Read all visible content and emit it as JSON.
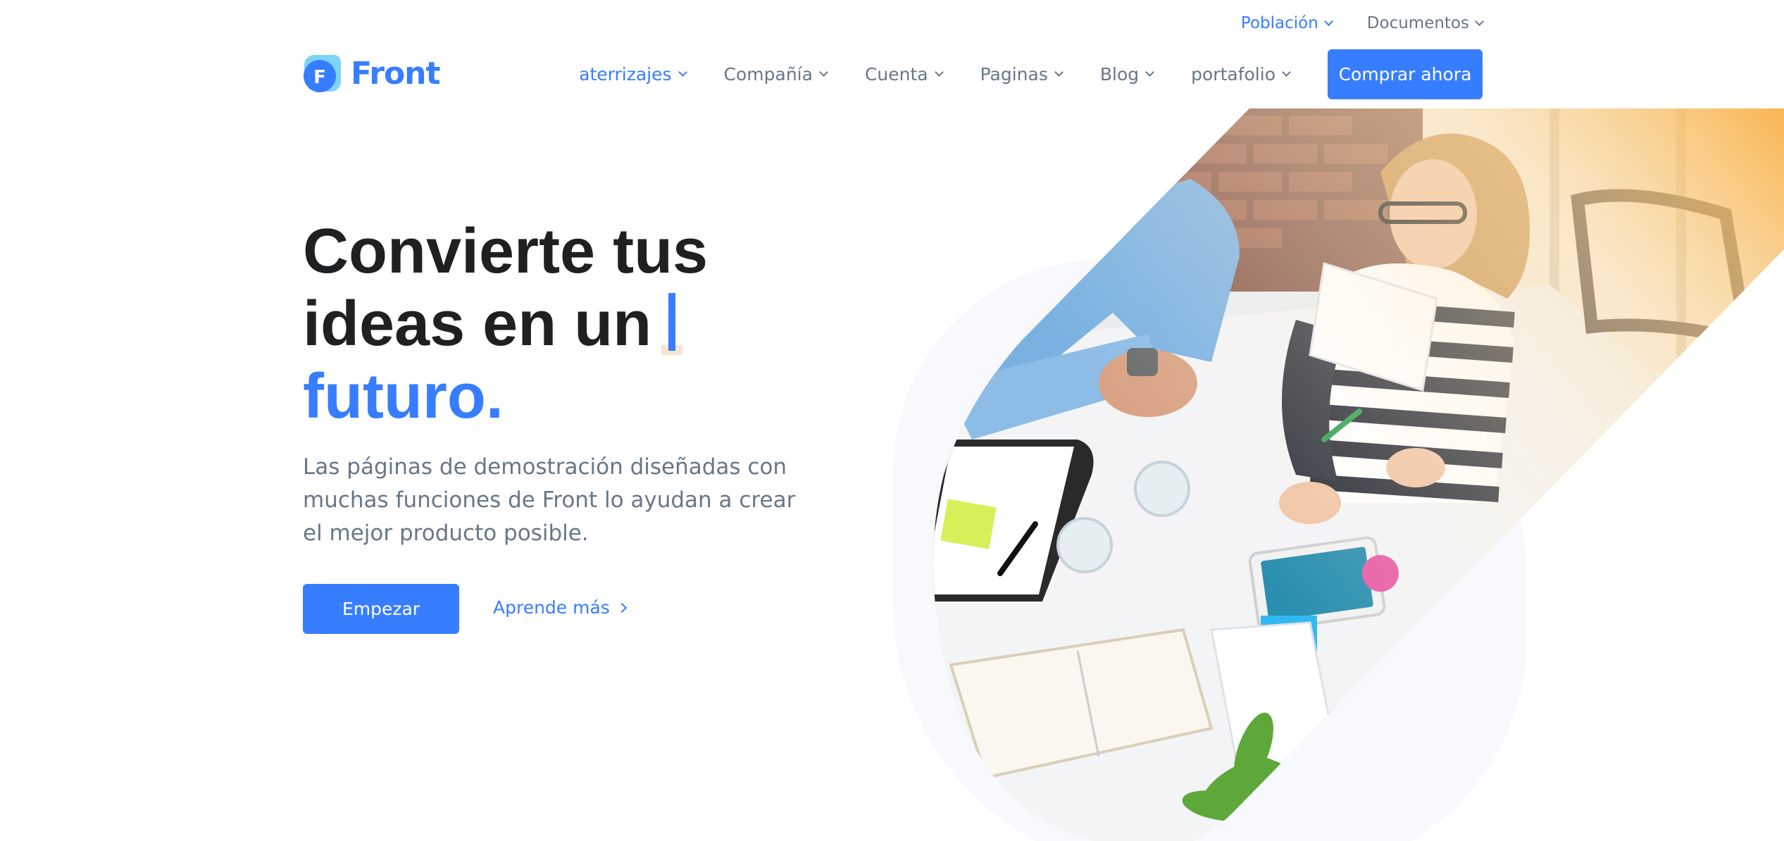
{
  "topbar": {
    "items": [
      {
        "label": "Población",
        "active": true
      },
      {
        "label": "Documentos",
        "active": false
      }
    ]
  },
  "brand": {
    "name": "Front",
    "mark_letter": "F"
  },
  "nav": {
    "items": [
      {
        "label": "aterrizajes",
        "active": true
      },
      {
        "label": "Compañía",
        "active": false
      },
      {
        "label": "Cuenta",
        "active": false
      },
      {
        "label": "Paginas",
        "active": false
      },
      {
        "label": "Blog",
        "active": false
      },
      {
        "label": "portafolio",
        "active": false
      }
    ],
    "cta_label": "Comprar ahora"
  },
  "hero": {
    "title_line1": "Convierte tus",
    "title_line2": "ideas en un",
    "title_accent": "futuro.",
    "subtitle": "Las páginas de demostración diseñadas con muchas funciones de Front lo ayudan a crear el mejor producto posible.",
    "primary_button": "Empezar",
    "secondary_link": "Aprende más"
  },
  "colors": {
    "primary": "#377dff",
    "heading": "#1e2022",
    "muted": "#677788",
    "highlight": "#fde6d0"
  },
  "icons": {
    "dropdown": "chevron-down-icon",
    "arrow": "chevron-right-icon",
    "logo": "front-logo-icon"
  }
}
